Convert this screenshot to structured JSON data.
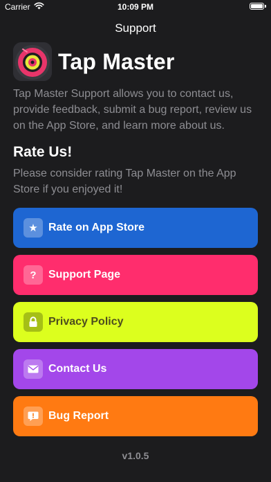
{
  "status_bar": {
    "carrier": "Carrier",
    "time": "10:09 PM",
    "icons": [
      "wifi-icon",
      "battery-icon"
    ]
  },
  "nav": {
    "title": "Support"
  },
  "app": {
    "name": "Tap Master",
    "icon": "app-logo-icon",
    "description": "Tap Master Support allows you to contact us, provide feedback, submit a bug report, review us on the App Store, and learn more about us."
  },
  "rate_section": {
    "title": "Rate Us!",
    "text": "Please consider rating Tap Master on the App Store if you enjoyed it!"
  },
  "actions": [
    {
      "label": "Rate on App Store",
      "icon": "star-icon",
      "glyph": "★",
      "color": "#1e66d2"
    },
    {
      "label": "Support Page",
      "icon": "question-icon",
      "glyph": "?",
      "color": "#ff2d6d"
    },
    {
      "label": "Privacy Policy",
      "icon": "lock-icon",
      "glyph": "",
      "color": "#dcff1e"
    },
    {
      "label": "Contact Us",
      "icon": "envelope-icon",
      "glyph": "",
      "color": "#a347ea"
    },
    {
      "label": "Bug Report",
      "icon": "speech-bubble-alert-icon",
      "glyph": "!",
      "color": "#ff7a12"
    }
  ],
  "footer": {
    "version": "v1.0.5"
  },
  "colors": {
    "background": "#1c1c1e",
    "secondary_text": "#8e8e93"
  }
}
